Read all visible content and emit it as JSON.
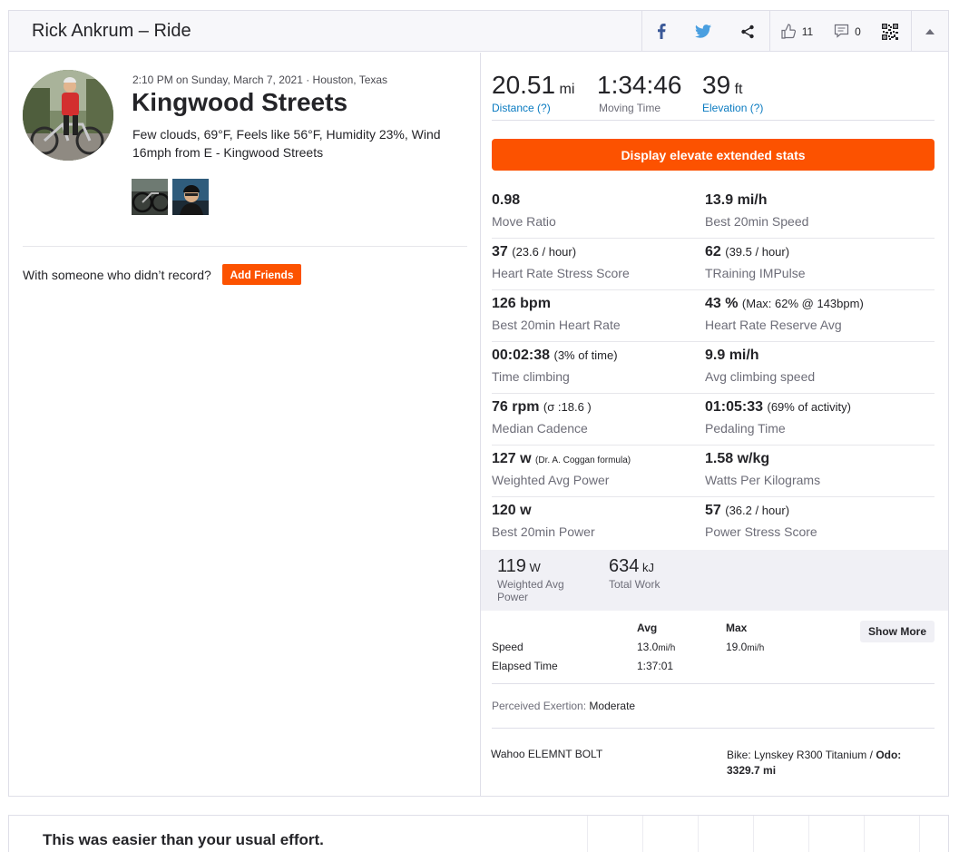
{
  "header": {
    "title": "Rick Ankrum – Ride",
    "kudos_count": "11",
    "comments_count": "0"
  },
  "icons": [
    "facebook-icon",
    "twitter-icon",
    "share-icon",
    "thumbs-up-icon",
    "comment-icon",
    "qr-code-icon",
    "collapse-caret-icon"
  ],
  "brand_colors": {
    "accent": "#fc5200",
    "facebook": "#3b5998",
    "twitter": "#1da1f2",
    "link": "#0a7bc1"
  },
  "activity": {
    "meta": "2:10 PM on Sunday, March 7, 2021 · Houston, Texas",
    "title": "Kingwood Streets",
    "description": "Few clouds, 69°F, Feels like 56°F, Humidity 23%, Wind 16mph from E - Kingwood Streets",
    "with_someone": "With someone who didn’t record?",
    "add_friends": "Add Friends"
  },
  "top_stats": {
    "distance": {
      "value": "20.51",
      "unit": "mi",
      "label": "Distance (?)"
    },
    "moving_time": {
      "value": "1:34:46",
      "label": "Moving Time"
    },
    "elevation": {
      "value": "39",
      "unit": "ft",
      "label": "Elevation (?)"
    }
  },
  "elevate_button": "Display elevate extended stats",
  "extended_stats": [
    {
      "left": {
        "value": "0.98",
        "extra": "",
        "label": "Move Ratio"
      },
      "right": {
        "value": "13.9 mi/h",
        "extra": "",
        "label": "Best 20min Speed"
      }
    },
    {
      "left": {
        "value": "37",
        "extra": "(23.6 / hour)",
        "label": "Heart Rate Stress Score"
      },
      "right": {
        "value": "62",
        "extra": "(39.5 / hour)",
        "label": "TRaining IMPulse"
      }
    },
    {
      "left": {
        "value": "126 bpm",
        "extra": "",
        "label": "Best 20min Heart Rate"
      },
      "right": {
        "value": "43 %",
        "extra": "(Max: 62% @ 143bpm)",
        "label": "Heart Rate Reserve Avg"
      }
    },
    {
      "left": {
        "value": "00:02:38",
        "extra": "(3% of time)",
        "label": "Time climbing"
      },
      "right": {
        "value": "9.9 mi/h",
        "extra": "",
        "label": "Avg climbing speed"
      }
    },
    {
      "left": {
        "value": "76 rpm",
        "extra": "(σ :18.6 )",
        "label": "Median Cadence"
      },
      "right": {
        "value": "01:05:33",
        "extra": "(69% of activity)",
        "label": "Pedaling Time"
      }
    },
    {
      "left": {
        "value": "127 w",
        "extra": "(Dr. A. Coggan formula)",
        "label": "Weighted Avg Power"
      },
      "right": {
        "value": "1.58 w/kg",
        "extra": "",
        "label": "Watts Per Kilograms"
      }
    },
    {
      "left": {
        "value": "120 w",
        "extra": "",
        "label": "Best 20min Power"
      },
      "right": {
        "value": "57",
        "extra": "(36.2 / hour)",
        "label": "Power Stress Score"
      }
    }
  ],
  "power": {
    "weighted_avg": {
      "value": "119",
      "unit": "W",
      "label": "Weighted Avg Power"
    },
    "total_work": {
      "value": "634",
      "unit": "kJ",
      "label": "Total Work"
    }
  },
  "summary_table": {
    "headers": {
      "avg": "Avg",
      "max": "Max"
    },
    "rows": [
      {
        "label": "Speed",
        "avg": "13.0",
        "avg_unit": "mi/h",
        "max": "19.0",
        "max_unit": "mi/h"
      },
      {
        "label": "Elapsed Time",
        "avg": "1:37:01",
        "avg_unit": "",
        "max": "",
        "max_unit": ""
      }
    ],
    "show_more": "Show More"
  },
  "perceived_exertion": {
    "label": "Perceived Exertion:",
    "value": "Moderate"
  },
  "device": "Wahoo ELEMNT BOLT",
  "bike": {
    "label": "Bike: Lynskey R300 Titanium /",
    "odo_label": "Odo:",
    "odo_value": "3329.7 mi"
  },
  "relative_effort": "This was easier than your usual effort."
}
